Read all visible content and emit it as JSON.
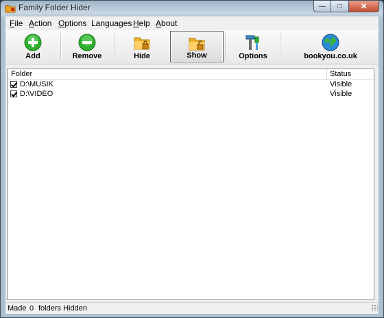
{
  "window": {
    "title": "Family Folder Hider"
  },
  "menu": [
    {
      "label": "File",
      "underline": "F",
      "rest": "ile"
    },
    {
      "label": "Action",
      "underline": "A",
      "rest": "ction"
    },
    {
      "label": "Options",
      "underline": "O",
      "rest": "ptions"
    },
    {
      "label": "Languages",
      "underline": "",
      "rest": "Languages"
    },
    {
      "label": "Help",
      "underline": "H",
      "rest": "elp"
    },
    {
      "label": "About",
      "underline": "A",
      "rest": "bout"
    }
  ],
  "toolbar": {
    "add_label": "Add",
    "remove_label": "Remove",
    "hide_label": "Hide",
    "show_label": "Show",
    "options_label": "Options",
    "website_label": "bookyou.co.uk"
  },
  "list": {
    "columns": {
      "folder": "Folder",
      "status": "Status"
    },
    "rows": [
      {
        "checked": true,
        "folder": "D:\\MUSIK",
        "status": "Visible"
      },
      {
        "checked": true,
        "folder": "D:\\VIDEO",
        "status": "Visible"
      }
    ]
  },
  "statusbar": {
    "made": "Made",
    "count": "0",
    "suffix": "folders Hidden"
  },
  "colors": {
    "add_green": "#2fae2f",
    "folder_orange": "#f0b429",
    "close_red": "#c74a32"
  },
  "icons": [
    "app-icon",
    "minimize-icon",
    "maximize-icon",
    "close-icon",
    "add-icon",
    "remove-icon",
    "folder-lock-icon",
    "folder-unlock-icon",
    "tools-icon",
    "globe-icon"
  ]
}
